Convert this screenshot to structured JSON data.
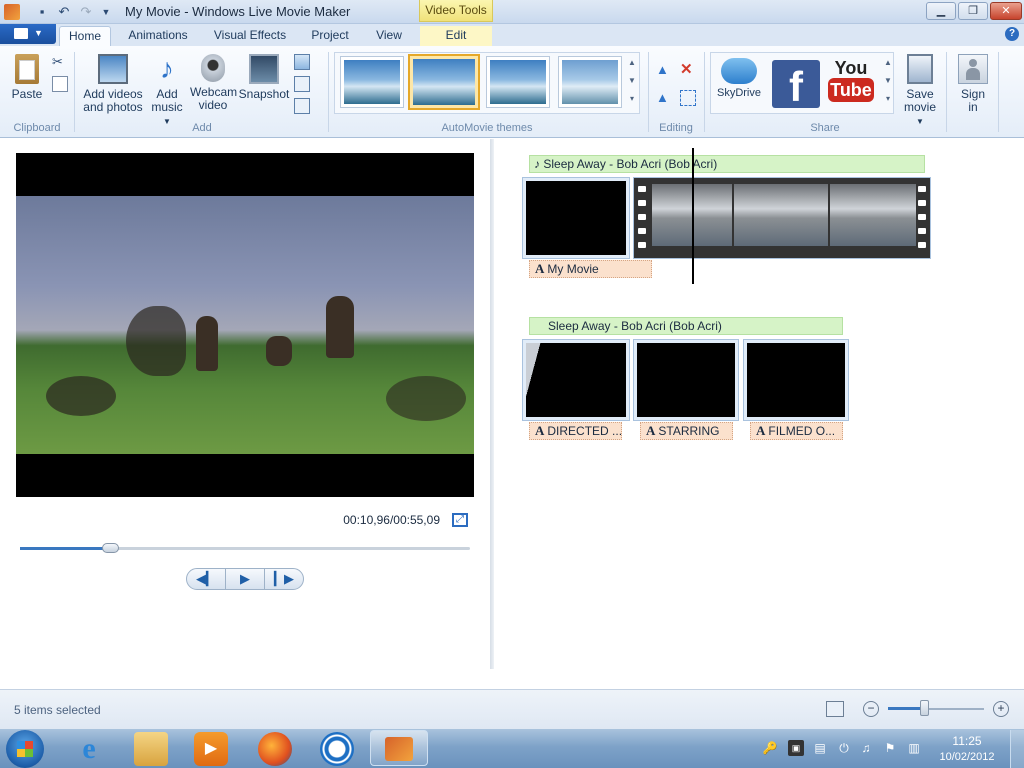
{
  "window": {
    "title": "My Movie - Windows Live Movie Maker",
    "context_tab": "Video Tools"
  },
  "ribbon_tabs": [
    {
      "label": "Home"
    },
    {
      "label": "Animations"
    },
    {
      "label": "Visual Effects"
    },
    {
      "label": "Project"
    },
    {
      "label": "View"
    },
    {
      "label": "Edit"
    }
  ],
  "clipboard": {
    "paste": "Paste",
    "group": "Clipboard"
  },
  "add": {
    "add_videos_l1": "Add videos",
    "add_videos_l2": "and photos",
    "add_music_l1": "Add",
    "add_music_l2": "music",
    "webcam_l1": "Webcam",
    "webcam_l2": "video",
    "snapshot": "Snapshot",
    "group": "Add"
  },
  "themes": {
    "group": "AutoMovie themes",
    "count": 4,
    "selected_index": 1
  },
  "editing": {
    "group": "Editing"
  },
  "share": {
    "group": "Share",
    "skydrive": "SkyDrive",
    "youtube_l1": "You",
    "youtube_l2": "Tube",
    "save_l1": "Save",
    "save_l2": "movie",
    "signin_l1": "Sign",
    "signin_l2": "in"
  },
  "player": {
    "time": "00:10,96/00:55,09",
    "progress_fraction": 0.199
  },
  "storyboard": {
    "music_1": "Sleep Away - Bob Acri (Bob Acri)",
    "caption_title": "My Movie",
    "music_2": "Sleep Away - Bob Acri (Bob Acri)",
    "captions": [
      "DIRECTED ...",
      "STARRING",
      "FILMED O..."
    ]
  },
  "status": {
    "text": "5 items selected",
    "zoom_fraction": 0.37
  },
  "taskbar": {
    "time": "11:25",
    "date": "10/02/2012"
  },
  "colors": {
    "accent": "#3a78c0",
    "music_bar": "#d6f3c7",
    "caption_bar": "#fbe1cd",
    "context_tab": "#f0e27a"
  }
}
